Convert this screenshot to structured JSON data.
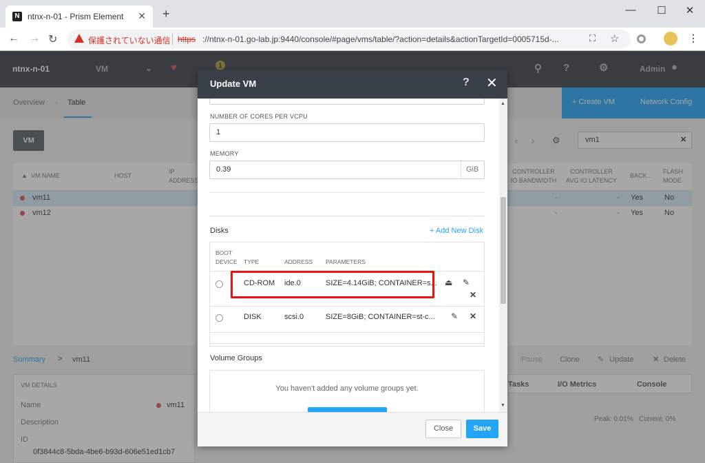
{
  "browser": {
    "tab_title": "ntnx-n-01 - Prism Element",
    "new_tab": "+",
    "warning": "保護されていない通信",
    "url_scheme": "https",
    "url_rest": "://ntnx-n-01.go-lab.jp:9440/console/#page/vms/table/?action=details&actionTargetId=0005715d-..."
  },
  "app": {
    "cluster": "ntnx-n-01",
    "section": "VM",
    "user": "Admin",
    "help": "?",
    "alert_count": "1"
  },
  "subnav": {
    "overview": "Overview",
    "table": "Table",
    "create_vm": "+ Create VM",
    "network_config": "Network Config"
  },
  "vm_button": "VM",
  "search_value": "vm1",
  "table": {
    "headers": [
      "VM NAME",
      "HOST",
      "IP ADDRESS",
      "CONTROLLER IO BANDWIDTH",
      "CONTROLLER AVG IO LATENCY",
      "BACK...",
      "FLASH MODE"
    ],
    "rows": [
      {
        "name": "vm11",
        "bw": "-",
        "lat": "-",
        "back": "Yes",
        "flash": "No"
      },
      {
        "name": "vm12",
        "bw": "-",
        "lat": "-",
        "back": "Yes",
        "flash": "No"
      }
    ]
  },
  "summary": {
    "link": "Summary",
    "sep": ">",
    "vm": "vm11",
    "actions": [
      "Pause",
      "Clone",
      "Update",
      "Delete"
    ],
    "tabs": [
      "Tasks",
      "I/O Metrics",
      "Console"
    ],
    "details_title": "VM DETAILS",
    "name_label": "Name",
    "name_value": "vm11",
    "desc_label": "Description",
    "id_label": "ID",
    "id_value": "0f3844c8-5bda-4be6-b93d-606e51ed1cb7",
    "peak": "Peak: 0.01%",
    "current": "Current: 0%"
  },
  "modal": {
    "title": "Update VM",
    "help": "?",
    "cores_label": "NUMBER OF CORES PER VCPU",
    "cores_value": "1",
    "memory_label": "MEMORY",
    "memory_value": "0.39",
    "memory_unit": "GiB",
    "disks_label": "Disks",
    "add_disk": "+ Add New Disk",
    "disk_headers": {
      "boot": "BOOT",
      "device": "DEVICE",
      "type": "TYPE",
      "address": "ADDRESS",
      "parameters": "PARAMETERS"
    },
    "disks": [
      {
        "type": "CD-ROM",
        "address": "ide.0",
        "params": "SIZE=4.14GiB; CONTAINER=s..."
      },
      {
        "type": "DISK",
        "address": "scsi.0",
        "params": "SIZE=8GiB; CONTAINER=st-c..."
      }
    ],
    "volume_groups_label": "Volume Groups",
    "volume_empty": "You haven't added any volume groups yet.",
    "close": "Close",
    "save": "Save"
  }
}
